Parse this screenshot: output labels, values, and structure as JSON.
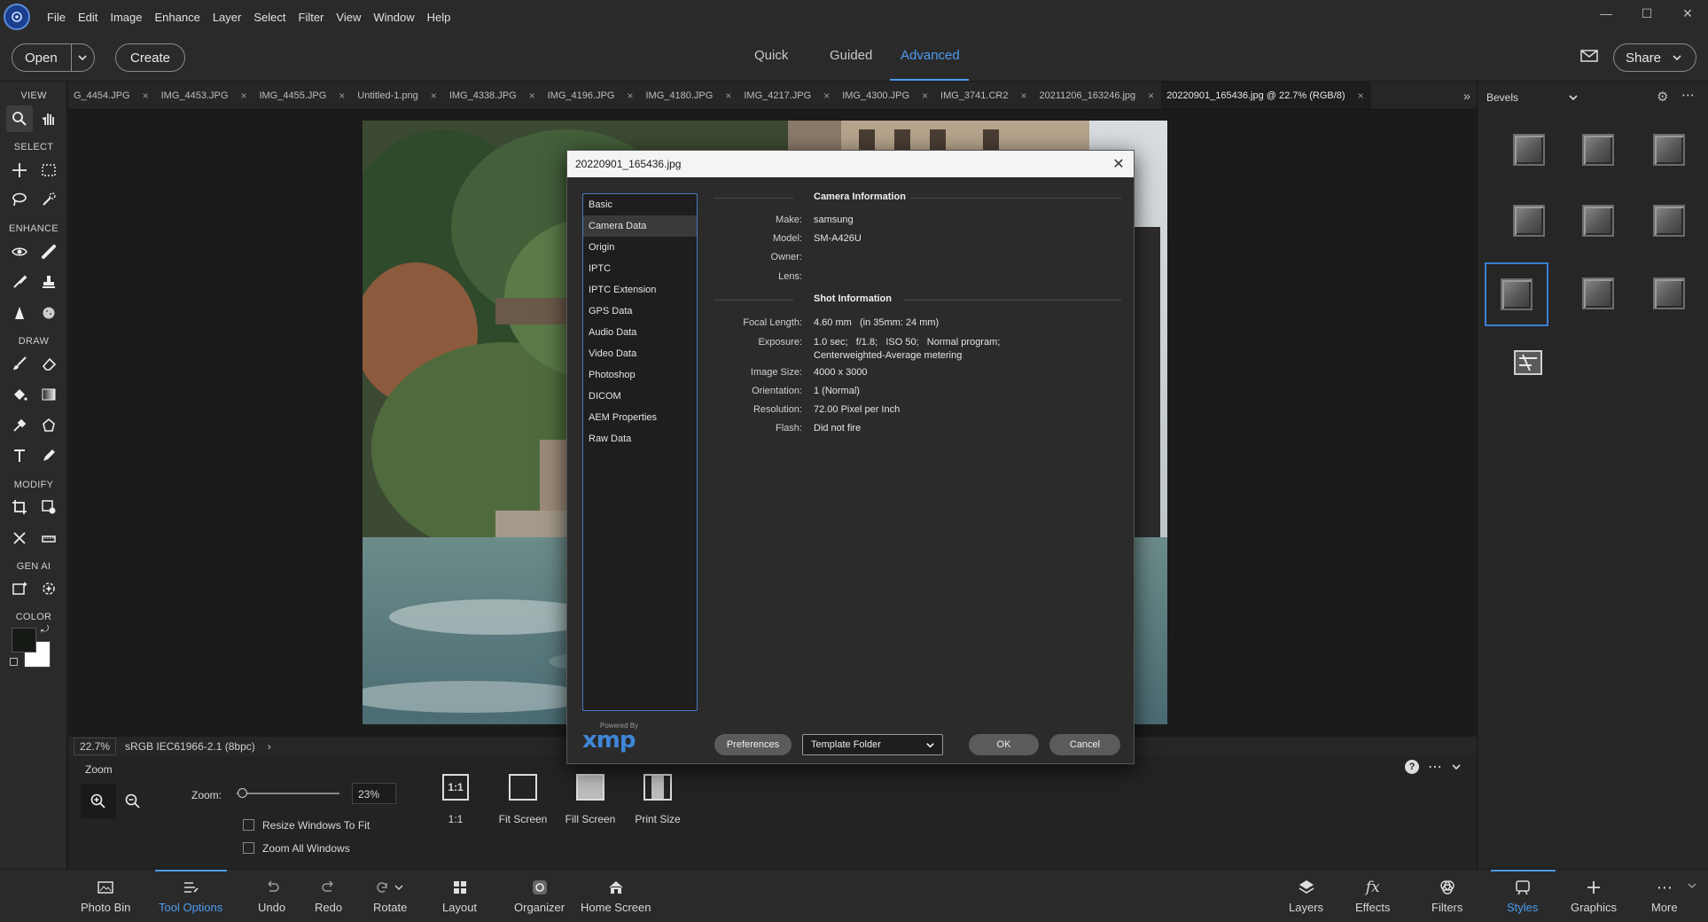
{
  "menu": [
    "File",
    "Edit",
    "Image",
    "Enhance",
    "Layer",
    "Select",
    "Filter",
    "View",
    "Window",
    "Help"
  ],
  "topbar": {
    "open_label": "Open",
    "create_label": "Create",
    "modes": [
      "Quick",
      "Guided",
      "Advanced"
    ],
    "active_mode": "Advanced",
    "share_label": "Share"
  },
  "toolbox": {
    "sections": [
      "VIEW",
      "SELECT",
      "ENHANCE",
      "DRAW",
      "MODIFY",
      "GEN AI",
      "COLOR"
    ]
  },
  "tabs": [
    "G_4454.JPG",
    "IMG_4453.JPG",
    "IMG_4455.JPG",
    "Untitled-1.png",
    "IMG_4338.JPG",
    "IMG_4196.JPG",
    "IMG_4180.JPG",
    "IMG_4217.JPG",
    "IMG_4300.JPG",
    "IMG_3741.CR2",
    "20211206_163246.jpg",
    "20220901_165436.jpg @ 22.7% (RGB/8)"
  ],
  "status": {
    "zoom": "22.7%",
    "profile": "sRGB IEC61966-2.1 (8bpc)"
  },
  "options": {
    "title": "Zoom",
    "zoom_label": "Zoom:",
    "zoom_value": "23%",
    "zoom_slider_fraction": 0.05,
    "checkbox_resize": "Resize Windows To Fit",
    "checkbox_zoom_all": "Zoom All Windows",
    "buttons": [
      "1:1",
      "Fit Screen",
      "Fill Screen",
      "Print Size"
    ]
  },
  "right_panel": {
    "category": "Bevels"
  },
  "bottom": {
    "left": [
      "Photo Bin",
      "Tool Options",
      "Undo",
      "Redo",
      "Rotate",
      "Layout",
      "Organizer",
      "Home Screen"
    ],
    "right": [
      "Layers",
      "Effects",
      "Filters",
      "Styles",
      "Graphics",
      "More"
    ],
    "active_left": "Tool Options",
    "active_right": "Styles"
  },
  "dialog": {
    "title": "20220901_165436.jpg",
    "categories": [
      "Basic",
      "Camera Data",
      "Origin",
      "IPTC",
      "IPTC Extension",
      "GPS Data",
      "Audio Data",
      "Video Data",
      "Photoshop",
      "DICOM",
      "AEM Properties",
      "Raw Data"
    ],
    "selected_category": "Camera Data",
    "camera_section": "Camera Information",
    "camera_rows": [
      {
        "label": "Make:",
        "value": "samsung"
      },
      {
        "label": "Model:",
        "value": "SM-A426U"
      },
      {
        "label": "Owner:",
        "value": ""
      },
      {
        "label": "Lens:",
        "value": ""
      }
    ],
    "shot_section": "Shot Information",
    "shot_rows": [
      {
        "label": "Focal Length:",
        "value": "4.60 mm   (in 35mm: 24 mm)"
      },
      {
        "label": "Exposure:",
        "value": "1.0 sec;   f/1.8;   ISO 50;   Normal program;   Centerweighted-Average metering"
      },
      {
        "label": "Image Size:",
        "value": "4000 x 3000"
      },
      {
        "label": "Orientation:",
        "value": "1 (Normal)"
      },
      {
        "label": "Resolution:",
        "value": "72.00 Pixel per Inch"
      },
      {
        "label": "Flash:",
        "value": "Did not fire"
      }
    ],
    "powered_by": "Powered By",
    "xmp": "xmp",
    "preferences_label": "Preferences",
    "template_select": "Template Folder",
    "ok_label": "OK",
    "cancel_label": "Cancel"
  }
}
